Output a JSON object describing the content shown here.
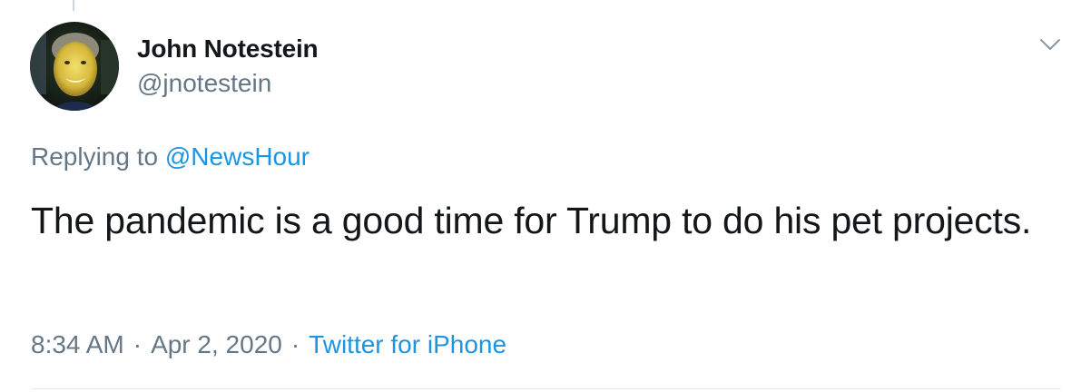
{
  "author": {
    "name": "John Notestein",
    "handle": "@jnotestein",
    "avatar_icon": "user-avatar-photo"
  },
  "reply": {
    "prefix": "Replying to",
    "mention": "@NewsHour"
  },
  "tweet": {
    "text": "The pandemic is a good time for Trump to do his pet projects."
  },
  "meta": {
    "time": "8:34 AM",
    "separator": "·",
    "date": "Apr 2, 2020",
    "source": "Twitter for iPhone"
  },
  "icons": {
    "menu": "chevron-down-icon"
  },
  "colors": {
    "text": "#14171a",
    "secondary": "#657786",
    "link": "#1b95e0",
    "divider": "#e6ecf0"
  }
}
